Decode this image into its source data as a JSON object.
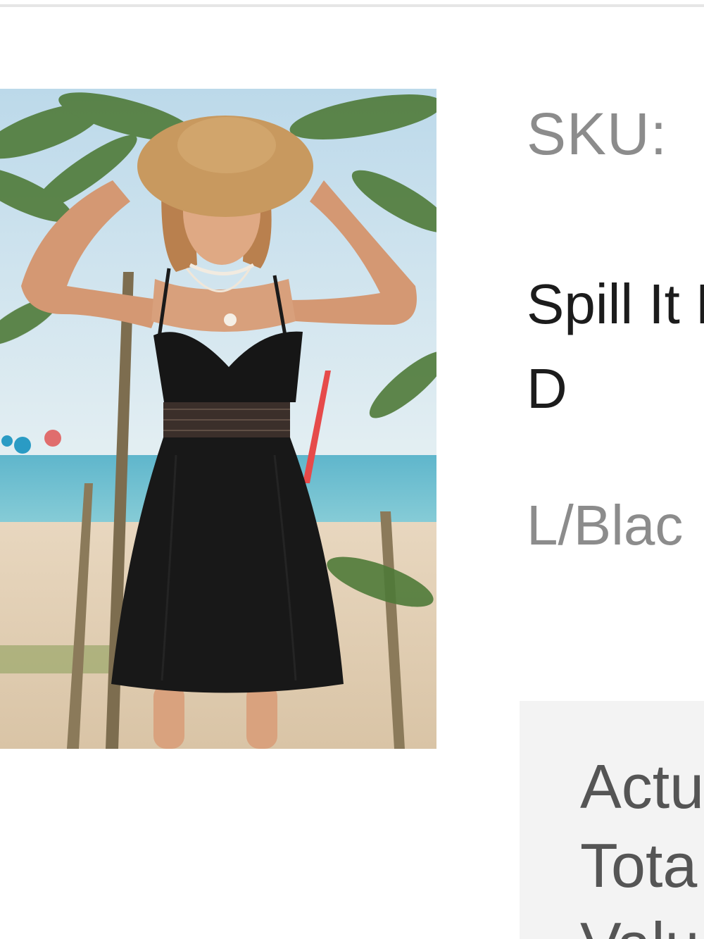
{
  "product": {
    "sku_label": "SKU: ",
    "title": "Spill It Mini D",
    "variant": "L/Blac"
  },
  "order_summary": {
    "lines": [
      "Actu",
      "Tota",
      "Valu"
    ]
  },
  "colors": {
    "background": "#ffffff",
    "summary_bg": "#f3f3f3",
    "muted_text": "#8c8c8c",
    "dark_text": "#1c1c1c"
  }
}
